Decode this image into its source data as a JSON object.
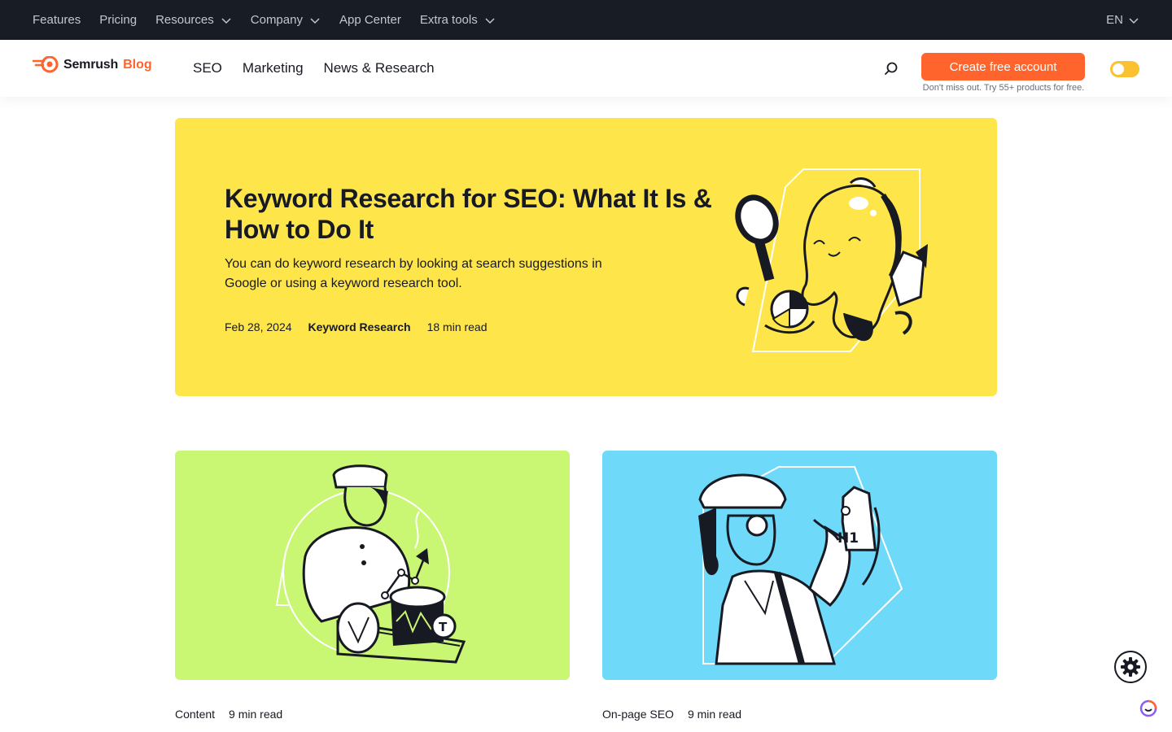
{
  "topbar": {
    "items": [
      {
        "label": "Features",
        "dropdown": false
      },
      {
        "label": "Pricing",
        "dropdown": false
      },
      {
        "label": "Resources",
        "dropdown": true
      },
      {
        "label": "Company",
        "dropdown": true
      },
      {
        "label": "App Center",
        "dropdown": false
      },
      {
        "label": "Extra tools",
        "dropdown": true
      }
    ],
    "lang": "EN"
  },
  "header": {
    "brand": "Semrush",
    "brand_suffix": "Blog",
    "nav": [
      "SEO",
      "Marketing",
      "News & Research"
    ],
    "cta_label": "Create free account",
    "cta_sub": "Don't miss out. Try 55+ products for free."
  },
  "hero": {
    "title": "Keyword Research for SEO: What It Is & How to Do It",
    "lead": "You can do keyword research by looking at search suggestions in Google or using a keyword research tool.",
    "date": "Feb 28, 2024",
    "category": "Keyword Research",
    "read_time": "18 min read"
  },
  "cards": [
    {
      "category": "Content",
      "read_time": "9 min read",
      "illustration": "chef-serving-chart-icon",
      "badge": "T"
    },
    {
      "category": "On-page SEO",
      "read_time": "9 min read",
      "illustration": "detective-with-h1-tag-icon",
      "badge": "H1"
    }
  ],
  "colors": {
    "topbar_bg": "#181c25",
    "accent": "#ff642d",
    "hero_bg": "#fee54a",
    "card1_bg": "#c9f774",
    "card2_bg": "#6fd9f9",
    "toggle": "#fcc131"
  }
}
